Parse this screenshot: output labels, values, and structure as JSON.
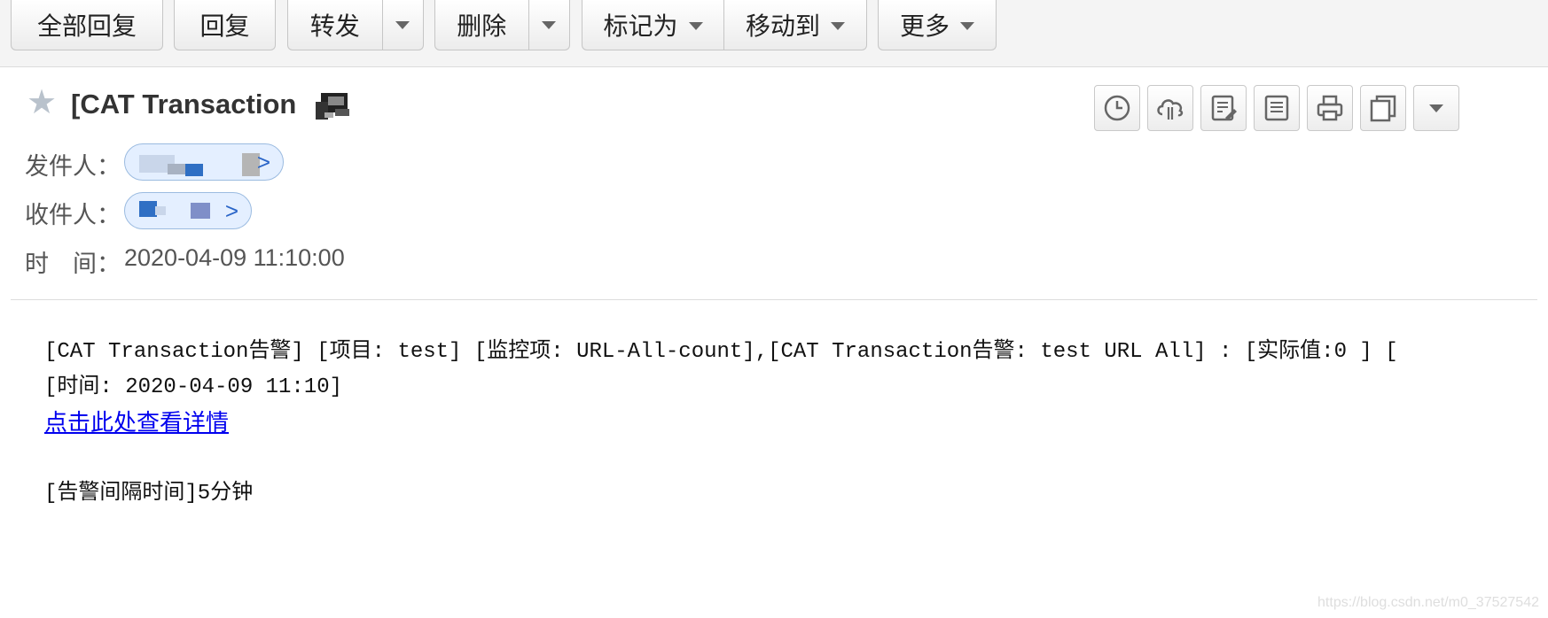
{
  "toolbar": {
    "reply_all": "全部回复",
    "reply": "回复",
    "forward": "转发",
    "delete": "删除",
    "mark_as": "标记为",
    "move_to": "移动到",
    "more": "更多"
  },
  "mail": {
    "subject": "[CAT Transaction",
    "sender_label": "发件人：",
    "recipient_label": "收件人：",
    "time_label": "时　间：",
    "time_value": "2020-04-09 11:10:00",
    "pill_arrow": ">"
  },
  "body": {
    "line1": "[CAT Transaction告警] [项目: test] [监控项: URL-All-count],[CAT Transaction告警: test URL All] : [实际值:0 ] [",
    "line2": "[时间: 2020-04-09 11:10]",
    "link_text": "点击此处查看详情",
    "line4": "[告警间隔时间]5分钟"
  },
  "watermark": "https://blog.csdn.net/m0_37527542",
  "icons": [
    "clock-icon",
    "cloud-icon",
    "edit-note-icon",
    "note-icon",
    "print-icon",
    "copy-icon",
    "more-actions-caret-icon"
  ],
  "colors": {
    "link": "#0000ee",
    "pill_bg": "#e4efff",
    "pill_border": "#9bbbe0",
    "toolbar_bg": "#f4f4f4"
  }
}
